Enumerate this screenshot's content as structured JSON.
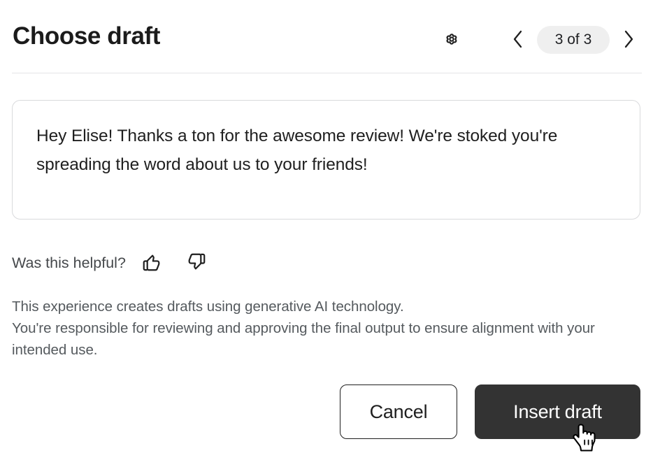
{
  "header": {
    "title": "Choose draft",
    "settings_icon": "gear-icon",
    "prev_icon": "chevron-left-icon",
    "next_icon": "chevron-right-icon",
    "pager_label": "3 of 3",
    "pager_current": 3,
    "pager_total": 3,
    "pill_bg": "#efefef"
  },
  "draft": {
    "text": "Hey Elise! Thanks a ton for the awesome review! We're stoked you're spreading the word about us to your friends!",
    "border_color": "#d9dadc"
  },
  "feedback": {
    "label": "Was this helpful?",
    "thumbs_up_icon": "thumbs-up-icon",
    "thumbs_down_icon": "thumbs-down-icon"
  },
  "disclaimer": {
    "line1": "This experience creates drafts using generative AI technology.",
    "line2": "You're responsible for reviewing and approving the final output to ensure alignment with your intended use."
  },
  "footer": {
    "cancel_label": "Cancel",
    "insert_label": "Insert draft",
    "primary_bg": "#333333",
    "primary_text_color": "#ffffff"
  },
  "cursor": {
    "type": "pointing-hand"
  }
}
